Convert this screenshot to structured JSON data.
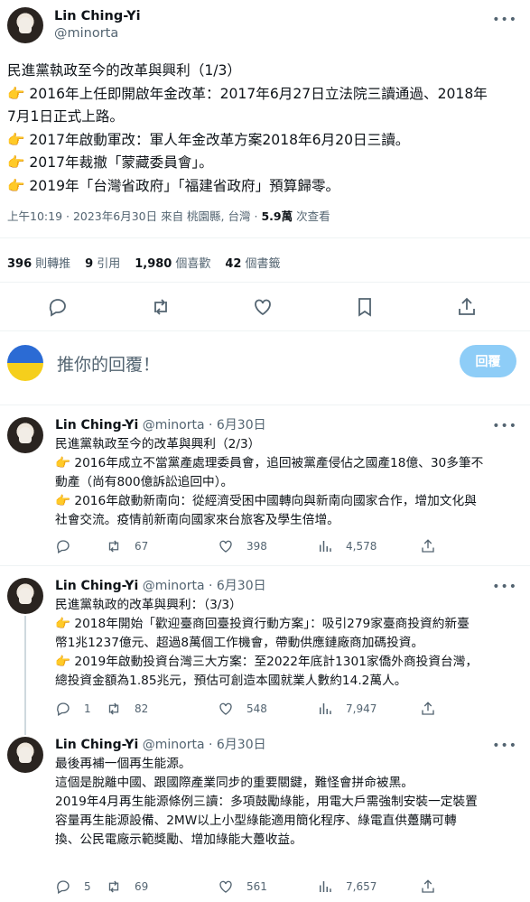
{
  "main": {
    "name": "Lin Ching-Yi",
    "handle": "@minorta",
    "lines": [
      "民進黨執政至今的改革與興利（1/3）",
      "👉 2016年上任即開啟年金改革：2017年6月27日立法院三讀通過、2018年",
      "7月1日正式上路。",
      "👉 2017年啟動軍改：軍人年金改革方案2018年6月20日三讀。",
      "👉 2017年裁撤「蒙藏委員會」。",
      "👉 2019年「台灣省政府」「福建省政府」預算歸零。"
    ],
    "meta_time": "上午10:19 · 2023年6月30日 來自 桃園縣, 台灣 · ",
    "meta_views": "5.9萬",
    "meta_views_label": " 次查看",
    "stats": [
      {
        "value": "396",
        "label": "則轉推"
      },
      {
        "value": "9",
        "label": "引用"
      },
      {
        "value": "1,980",
        "label": "個喜歡"
      },
      {
        "value": "42",
        "label": "個書籤"
      }
    ]
  },
  "reply": {
    "placeholder": "推你的回覆！",
    "button": "回覆"
  },
  "replies": [
    {
      "name": "Lin Ching-Yi",
      "meta": "@minorta · 6月30日",
      "lines": [
        "民進黨執政至今的改革與興利（2/3）",
        "👉 2016年成立不當黨產處理委員會，追回被黨產侵佔之國產18億、30多筆不",
        "動產（尚有800億訴訟追回中）。",
        "👉 2016年啟動新南向：從經濟受困中國轉向與新南向國家合作，增加文化與",
        "社會交流。疫情前新南向國家來台旅客及學生倍增。"
      ],
      "replies": "",
      "retweets": "67",
      "likes": "398",
      "views": "4,578"
    },
    {
      "name": "Lin Ching-Yi",
      "meta": "@minorta · 6月30日",
      "lines": [
        "民進黨執政的改革與興利：（3/3）",
        "👉 2018年開始「歡迎臺商回臺投資行動方案」：吸引279家臺商投資約新臺",
        "幣1兆1237億元、超過8萬個工作機會，帶動供應鏈廠商加碼投資。",
        "👉 2019年啟動投資台灣三大方案：至2022年底計1301家僑外商投資台灣，",
        "總投資金額為1.85兆元，預估可創造本國就業人數約14.2萬人。"
      ],
      "replies": "1",
      "retweets": "82",
      "likes": "548",
      "views": "7,947"
    },
    {
      "name": "Lin Ching-Yi",
      "meta": "@minorta · 6月30日",
      "lines": [
        "最後再補一個再生能源。",
        "這個是脫離中國、跟國際產業同步的重要關鍵，難怪會拼命被黑。",
        "",
        "2019年4月再生能源條例三讀：多項鼓勵綠能，用電大戶需強制安裝一定裝置",
        "容量再生能源設備、2MW以上小型綠能適用簡化程序、綠電直供躉購可轉",
        "換、公民電廠示範獎勵、增加綠能大躉收益。"
      ],
      "replies": "5",
      "retweets": "69",
      "likes": "561",
      "views": "7,657"
    }
  ]
}
